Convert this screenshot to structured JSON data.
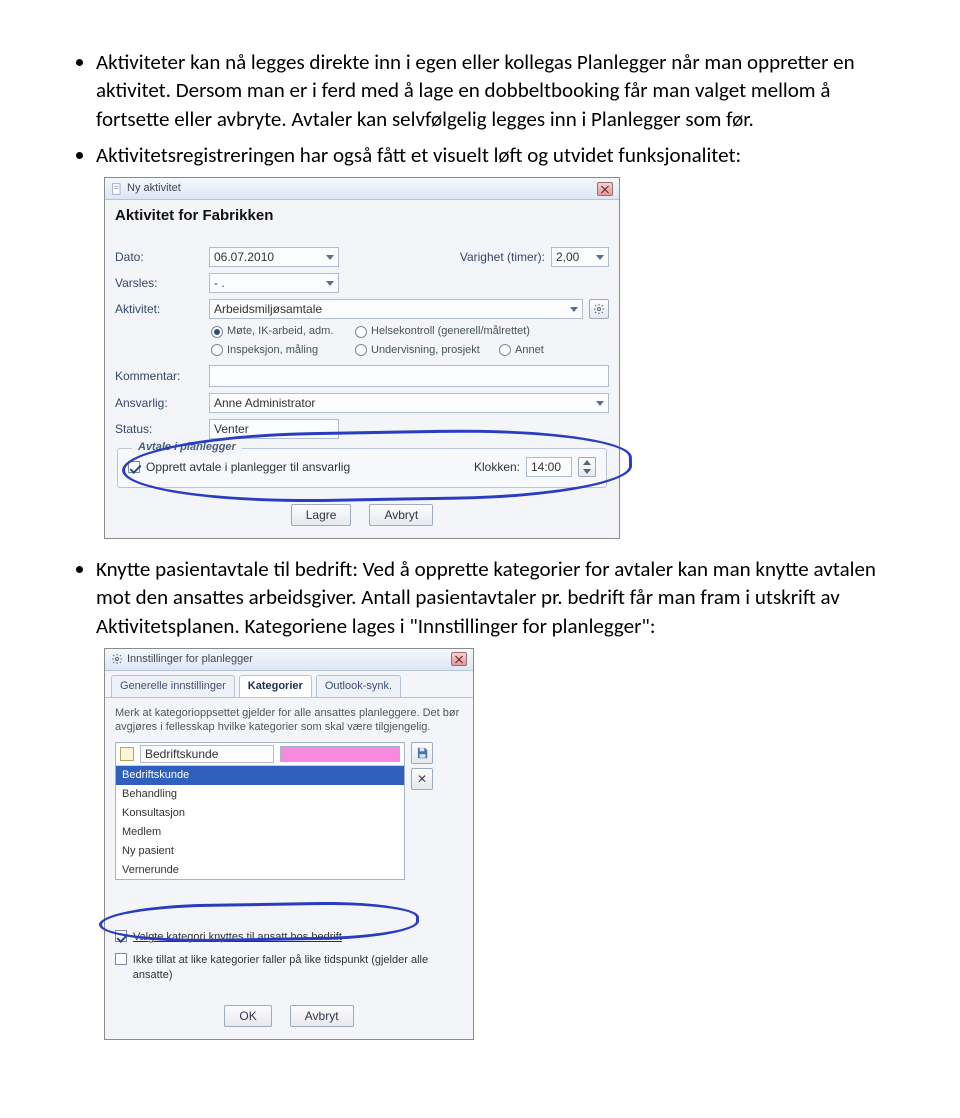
{
  "bullets": {
    "b1": "Aktiviteter kan nå legges direkte inn i egen eller kollegas Planlegger når man oppretter en aktivitet. Dersom man er i ferd med å lage en dobbeltbooking får man valget mellom å fortsette eller avbryte. Avtaler kan selvfølgelig legges inn i Planlegger som før.",
    "b2": "Aktivitetsregistreringen har også fått et visuelt løft og utvidet funksjonalitet:",
    "b3": "Knytte pasientavtale til bedrift: Ved å opprette kategorier for avtaler kan man knytte avtalen mot den ansattes arbeidsgiver. Antall pasientavtaler pr. bedrift får man fram i utskrift av Aktivitetsplanen. Kategoriene lages i \"Innstillinger for planlegger\":"
  },
  "activity": {
    "windowTitle": "Ny aktivitet",
    "heading": "Aktivitet for Fabrikken",
    "labels": {
      "dato": "Dato:",
      "varighet": "Varighet (timer):",
      "varsles": "Varsles:",
      "aktivitet": "Aktivitet:",
      "kommentar": "Kommentar:",
      "ansvarlig": "Ansvarlig:",
      "status": "Status:"
    },
    "values": {
      "dato": "06.07.2010",
      "varighet": "2,00",
      "varsles": "- .",
      "aktivitet": "Arbeidsmiljøsamtale",
      "ansvarlig": "Anne Administrator",
      "status": "Venter"
    },
    "radios": {
      "mote": "Møte, IK-arbeid, adm.",
      "helse": "Helsekontroll (generell/målrettet)",
      "inspeksjon": "Inspeksjon, måling",
      "undervisning": "Undervisning, prosjekt",
      "annet": "Annet"
    },
    "frame": {
      "legend": "Avtale i planlegger",
      "checkbox": "Opprett avtale i planlegger til ansvarlig",
      "klokkenLabel": "Klokken:",
      "klokken": "14:00"
    },
    "buttons": {
      "lagre": "Lagre",
      "avbryt": "Avbryt"
    }
  },
  "settings": {
    "windowTitle": "Innstillinger for planlegger",
    "tabs": {
      "t1": "Generelle innstillinger",
      "t2": "Kategorier",
      "t3": "Outlook-synk."
    },
    "note": "Merk at kategorioppsettet gjelder for alle ansattes planleggere. Det bør avgjøres i fellesskap hvilke kategorier som skal være tilgjengelig.",
    "editValue": "Bedriftskunde",
    "listItems": [
      "Bedriftskunde",
      "Behandling",
      "Konsultasjon",
      "Medlem",
      "Ny pasient",
      "Vernerunde"
    ],
    "selectedIndex": 0,
    "check1": "Valgte kategori knyttes til ansatt hos bedrift",
    "check2": "Ikke tillat at like kategorier faller på like tidspunkt (gjelder alle ansatte)",
    "buttons": {
      "ok": "OK",
      "avbryt": "Avbryt"
    }
  }
}
